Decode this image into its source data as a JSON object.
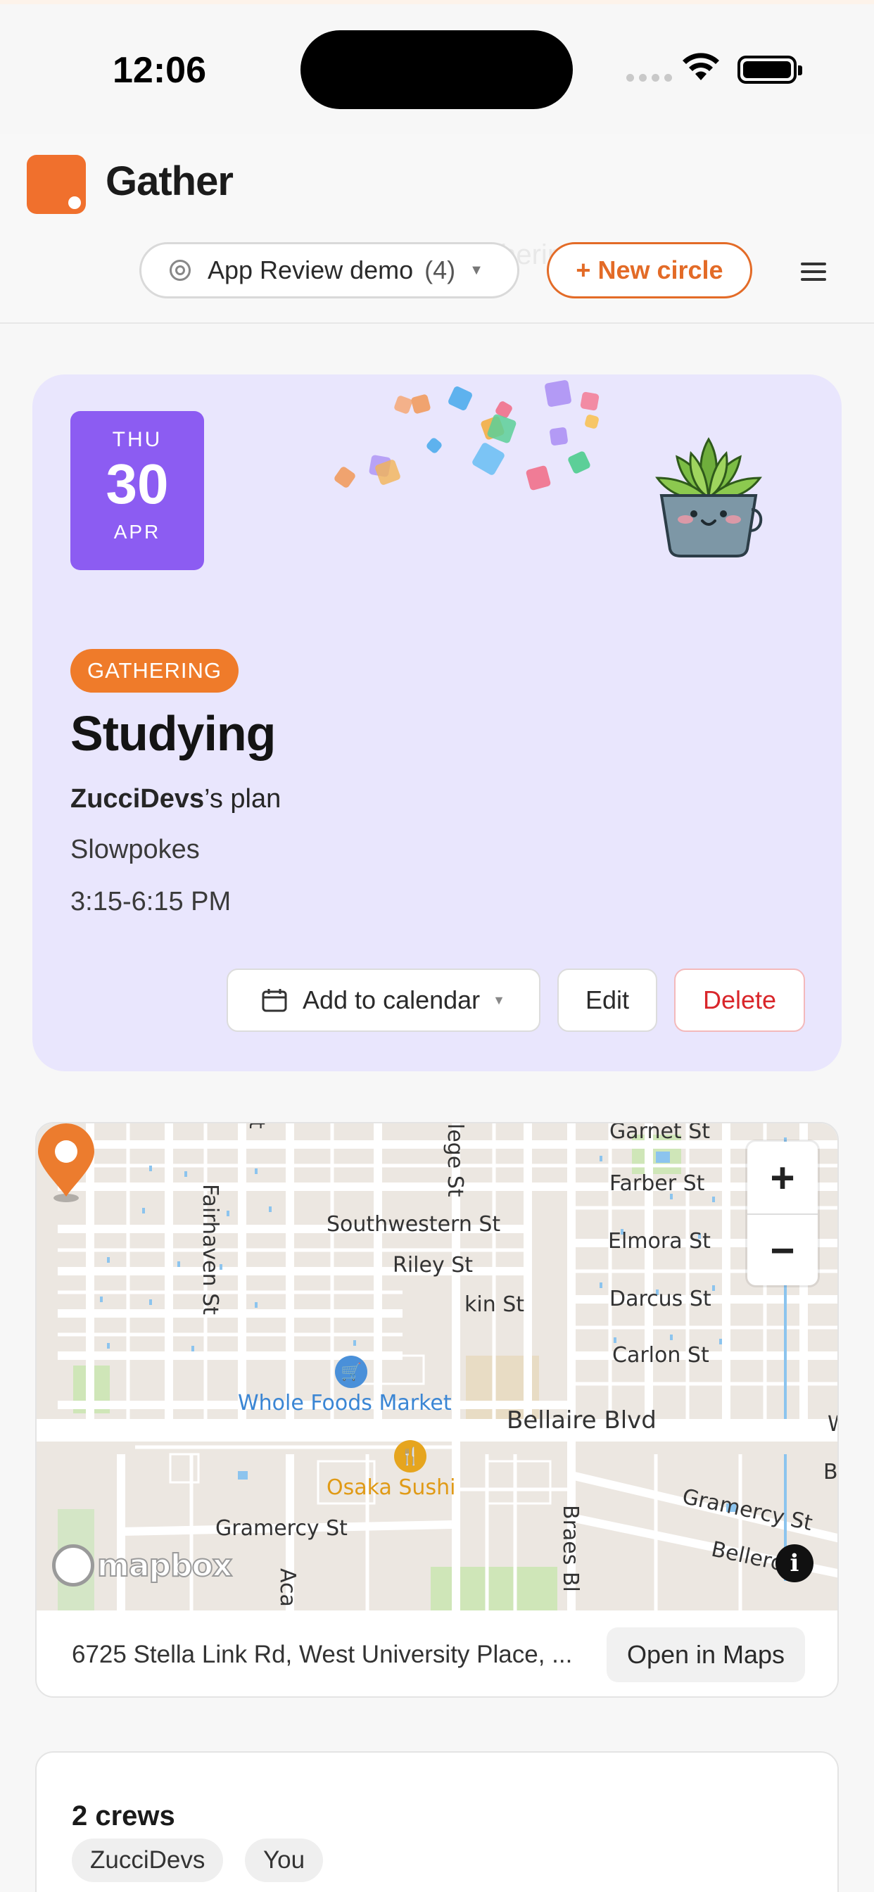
{
  "status_bar": {
    "time": "12:06"
  },
  "header": {
    "brand": "Gather",
    "circle_selector": {
      "name": "App Review demo",
      "count": "(4)"
    },
    "new_circle_label": "+ New circle",
    "ghost_text": "therings"
  },
  "event": {
    "date": {
      "weekday": "THU",
      "day": "30",
      "month": "APR"
    },
    "tag": "GATHERING",
    "title": "Studying",
    "owner": "ZucciDevs",
    "owner_suffix": "’s plan",
    "place": "Slowpokes",
    "time": "3:15-6:15 PM",
    "actions": {
      "calendar": "Add to calendar",
      "edit": "Edit",
      "delete": "Delete"
    },
    "colors": {
      "card": "#e9e6fd",
      "date_box": "#8c5cf2",
      "tag": "#ef7b2a",
      "delete": "#d9262b"
    }
  },
  "map": {
    "labels": {
      "garnet": "Garnet St",
      "farber": "Farber St",
      "southwestern": "Southwestern St",
      "elmora": "Elmora St",
      "riley": "Riley St",
      "darcus": "Darcus St",
      "kin": "kin St",
      "carlon": "Carlon St",
      "bellaire": "Bellaire Blvd",
      "gramercy_left": "Gramercy St",
      "gramercy_right": "Gramercy St",
      "belleron": "Belleron",
      "fairhaven": "Fairhaven St",
      "college": "lege St",
      "braes": "Braes Bl",
      "aca": "Aca",
      "t_label": "t",
      "w_edge": "W",
      "b_edge": "B"
    },
    "pois": {
      "whole_foods": "Whole Foods Market",
      "osaka": "Osaka Sushi"
    },
    "attribution": "mapbox",
    "address": "6725 Stella Link Rd, West University Place, ...",
    "open_label": "Open in Maps"
  },
  "crews": {
    "title": "2 crews",
    "members": [
      "ZucciDevs",
      "You"
    ]
  }
}
